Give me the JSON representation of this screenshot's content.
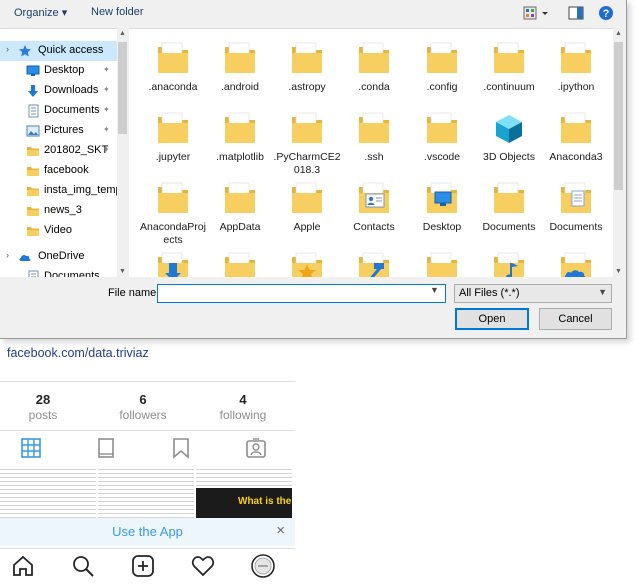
{
  "toolbar": {
    "organize": "Organize ▾",
    "new_folder": "New folder"
  },
  "nav_pane": {
    "items": [
      {
        "label": "Quick access",
        "icon": "star-icon",
        "pinned": false,
        "selected": true
      },
      {
        "label": "Desktop",
        "icon": "desktop-icon",
        "pinned": true
      },
      {
        "label": "Downloads",
        "icon": "download-icon",
        "pinned": true
      },
      {
        "label": "Documents",
        "icon": "documents-icon",
        "pinned": true
      },
      {
        "label": "Pictures",
        "icon": "pictures-icon",
        "pinned": true
      },
      {
        "label": "201802_SKT",
        "icon": "folder-icon",
        "pinned": true
      },
      {
        "label": "facebook",
        "icon": "folder-icon",
        "pinned": false
      },
      {
        "label": "insta_img_temp",
        "icon": "folder-icon",
        "pinned": false
      },
      {
        "label": "news_3",
        "icon": "folder-icon",
        "pinned": false
      },
      {
        "label": "Video",
        "icon": "folder-icon",
        "pinned": false
      },
      {
        "label": "OneDrive",
        "icon": "cloud-icon",
        "pinned": false
      },
      {
        "label": "Documents",
        "icon": "documents-icon",
        "pinned": false
      }
    ]
  },
  "files": [
    {
      "label": ".anaconda",
      "icon": "folder-icon"
    },
    {
      "label": ".android",
      "icon": "folder-icon"
    },
    {
      "label": ".astropy",
      "icon": "folder-icon"
    },
    {
      "label": ".conda",
      "icon": "folder-icon"
    },
    {
      "label": ".config",
      "icon": "folder-icon"
    },
    {
      "label": ".continuum",
      "icon": "folder-icon"
    },
    {
      "label": ".ipython",
      "icon": "folder-icon"
    },
    {
      "label": ".jupyter",
      "icon": "folder-icon"
    },
    {
      "label": ".matplotlib",
      "icon": "folder-icon"
    },
    {
      "label": ".PyCharmCE2018.3",
      "icon": "folder-icon"
    },
    {
      "label": ".ssh",
      "icon": "folder-icon"
    },
    {
      "label": ".vscode",
      "icon": "folder-icon"
    },
    {
      "label": "3D Objects",
      "icon": "3d-objects-icon"
    },
    {
      "label": "Anaconda3",
      "icon": "folder-icon"
    },
    {
      "label": "AnacondaProjects",
      "icon": "folder-icon"
    },
    {
      "label": "AppData",
      "icon": "folder-icon"
    },
    {
      "label": "Apple",
      "icon": "folder-icon"
    },
    {
      "label": "Contacts",
      "icon": "contacts-icon"
    },
    {
      "label": "Desktop",
      "icon": "desktop-folder-icon"
    },
    {
      "label": "Documents",
      "icon": "folder-icon"
    },
    {
      "label": "Documents",
      "icon": "documents-folder-icon"
    },
    {
      "label": "",
      "icon": "downloads-folder-icon"
    },
    {
      "label": "",
      "icon": "folder-icon"
    },
    {
      "label": "",
      "icon": "favorites-folder-icon"
    },
    {
      "label": "",
      "icon": "links-folder-icon"
    },
    {
      "label": "",
      "icon": "folder-icon"
    },
    {
      "label": "",
      "icon": "music-folder-icon"
    },
    {
      "label": "",
      "icon": "onedrive-folder-icon"
    }
  ],
  "bottom": {
    "file_name_label": "File name:",
    "file_name_value": "",
    "file_type": "All Files (*.*)",
    "open": "Open",
    "cancel": "Cancel"
  },
  "instagram": {
    "link": "facebook.com/data.triviaz",
    "stats": [
      {
        "num": "28",
        "label": "posts"
      },
      {
        "num": "6",
        "label": "followers"
      },
      {
        "num": "4",
        "label": "following"
      }
    ],
    "thumb_text": "What is the",
    "use_app": "Use the App",
    "close": "×"
  },
  "colors": {
    "accent": "#0078d7",
    "folder": "#f3c853",
    "ig_link": "#1f3c88",
    "ig_blue": "#3897f0"
  }
}
